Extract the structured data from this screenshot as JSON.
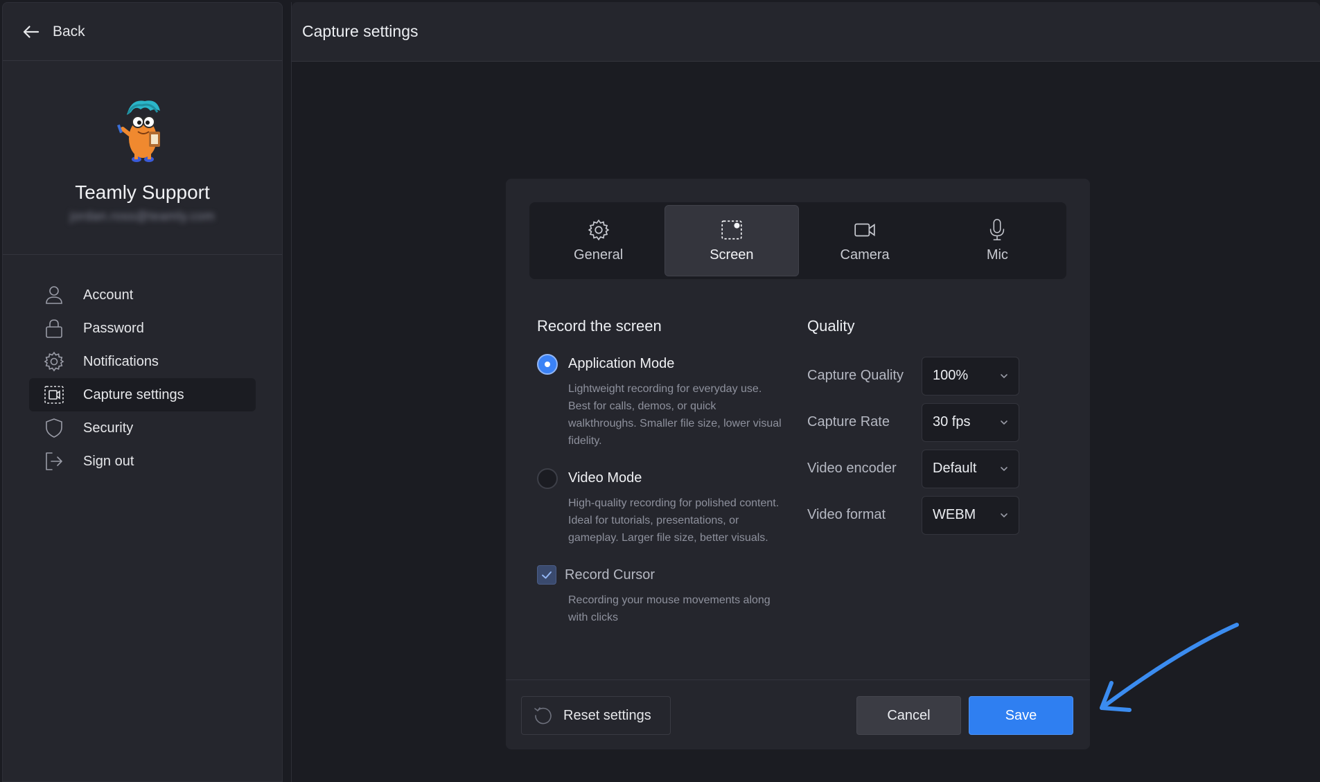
{
  "sidebar": {
    "back_label": "Back",
    "profile": {
      "name": "Teamly Support",
      "email": "jordan.ross@teamly.com"
    },
    "items": [
      {
        "label": "Account",
        "icon": "user-icon"
      },
      {
        "label": "Password",
        "icon": "lock-icon"
      },
      {
        "label": "Notifications",
        "icon": "gear-icon"
      },
      {
        "label": "Capture settings",
        "icon": "screen-capture-icon",
        "active": true
      },
      {
        "label": "Security",
        "icon": "shield-icon"
      },
      {
        "label": "Sign out",
        "icon": "sign-out-icon"
      }
    ]
  },
  "main": {
    "title": "Capture settings"
  },
  "dialog": {
    "tabs": [
      {
        "label": "General",
        "icon": "gear-icon"
      },
      {
        "label": "Screen",
        "icon": "screen-capture-icon",
        "active": true
      },
      {
        "label": "Camera",
        "icon": "camera-icon"
      },
      {
        "label": "Mic",
        "icon": "microphone-icon"
      }
    ],
    "record": {
      "title": "Record the screen",
      "application_mode": {
        "title": "Application Mode",
        "desc": "Lightweight recording for everyday use. Best for calls, demos, or quick walkthroughs. Smaller file size, lower visual fidelity.",
        "selected": true
      },
      "video_mode": {
        "title": "Video Mode",
        "desc": "High-quality recording for polished content. Ideal for tutorials, presentations, or gameplay. Larger file size, better visuals.",
        "selected": false
      },
      "record_cursor": {
        "title": "Record Cursor",
        "desc": "Recording your mouse movements along with clicks",
        "checked": true
      }
    },
    "quality": {
      "title": "Quality",
      "rows": [
        {
          "label": "Capture Quality",
          "value": "100%"
        },
        {
          "label": "Capture Rate",
          "value": "30 fps"
        },
        {
          "label": "Video encoder",
          "value": "Default"
        },
        {
          "label": "Video format",
          "value": "WEBM"
        }
      ]
    },
    "footer": {
      "reset_label": "Reset settings",
      "cancel_label": "Cancel",
      "save_label": "Save"
    }
  },
  "colors": {
    "accent": "#2f7ff1",
    "background": "#1b1c22",
    "panel": "#25262d",
    "annotation_arrow": "#3b8cf0"
  }
}
